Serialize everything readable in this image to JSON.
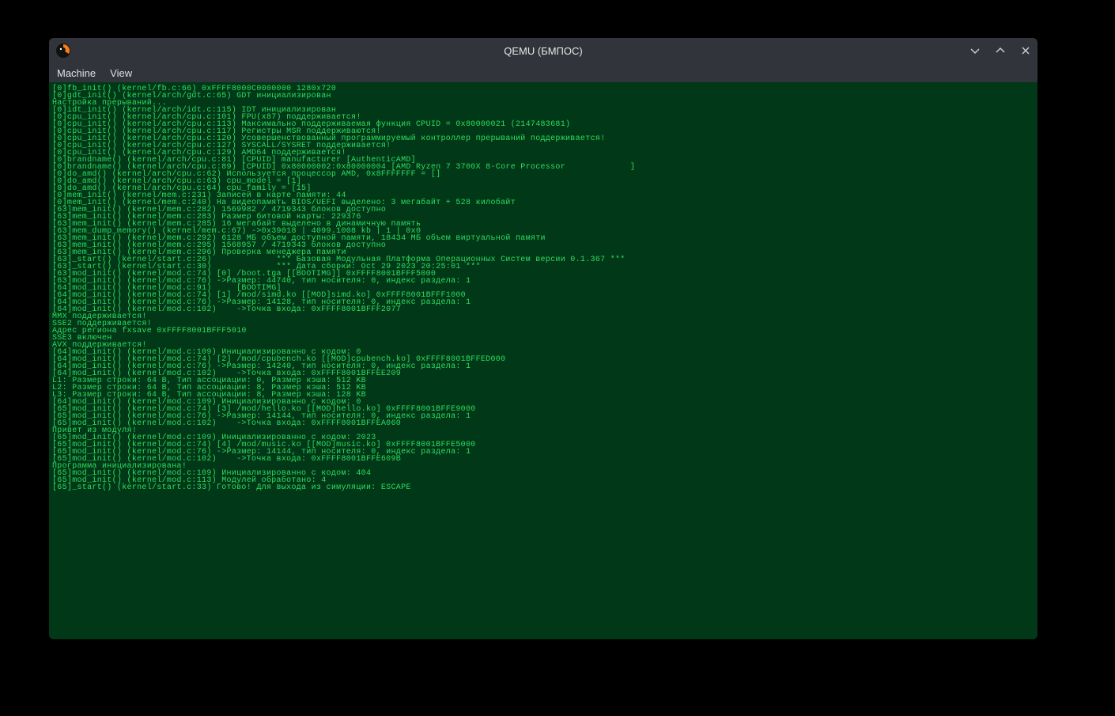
{
  "window": {
    "title": "QEMU (БМПОС)"
  },
  "menu": {
    "machine": "Machine",
    "view": "View"
  },
  "console": {
    "lines": [
      "[0]fb_init() (kernel/fb.c:66) 0xFFFF8000C0000000 1280x720",
      "[0]gdt_init() (kernel/arch/gdt.c:65) GDT инициализирован",
      "Настройка прерываний...",
      "[0]idt_init() (kernel/arch/idt.c:115) IDT инициализирован",
      "[0]cpu_init() (kernel/arch/cpu.c:101) FPU(x87) поддерживается!",
      "[0]cpu_init() (kernel/arch/cpu.c:113) Максимально поддерживаемая функция CPUID = 0x80000021 (2147483681)",
      "[0]cpu_init() (kernel/arch/cpu.c:117) Регистры MSR поддерживаются!",
      "[0]cpu_init() (kernel/arch/cpu.c:120) Усовершенствованный программируемый контроллер прерываний поддерживается!",
      "[0]cpu_init() (kernel/arch/cpu.c:127) SYSCALL/SYSRET поддерживается!",
      "[0]cpu_init() (kernel/arch/cpu.c:129) AMD64 поддерживается!",
      "[0]brandname() (kernel/arch/cpu.c:81) [CPUID] manufacturer [AuthenticAMD]",
      "[0]brandname() (kernel/arch/cpu.c:89) [CPUID] 0x80000002:0x80000004 [AMD Ryzen 7 3700X 8-Core Processor             ]",
      "[0]do_amd() (kernel/arch/cpu.c:62) Используется процессор AMD, 0x8FFFFFFF = []",
      "[0]do_amd() (kernel/arch/cpu.c:63) cpu_model = [1]",
      "[0]do_amd() (kernel/arch/cpu.c:64) cpu_family = [15]",
      "[0]mem_init() (kernel/mem.c:231) Записей в карте памяти: 44",
      "[0]mem_init() (kernel/mem.c:240) На видеопамять BIOS/UEFI выделено: 3 мегабайт + 528 килобайт",
      "[63]mem_init() (kernel/mem.c:282) 1569982 / 4719343 блоков доступно",
      "[63]mem_init() (kernel/mem.c:283) Размер битовой карты: 229376",
      "[63]mem_init() (kernel/mem.c:285) 16 мегабайт выделено в динамичную память",
      "[63]mem_dump_memory() (kernel/mem.c:67) ->0x39018 | 4099.1008 kb | 1 | 0x0",
      "[63]mem_init() (kernel/mem.c:292) 6128 МБ объем доступной памяти, 18434 МБ объем виртуальной памяти",
      "[63]mem_init() (kernel/mem.c:295) 1568957 / 4719343 блоков доступно",
      "[63]mem_init() (kernel/mem.c:296) Проверка менеджера памяти",
      "[63]_start() (kernel/start.c:26)             *** Базовая Модульная Платформа Операционных Систем версии 0.1.367 ***",
      "[63]_start() (kernel/start.c:30)             *** Дата сборки: Oct 29 2023 20:25:01 ***",
      "[63]mod_init() (kernel/mod.c:74) [0] /boot.tga [[BOOTIMG]] 0xFFFF8001BFFF5000",
      "[63]mod_init() (kernel/mod.c:76) ->Размер: 44740, тип носителя: 0, индекс раздела: 1",
      "[64]mod_init() (kernel/mod.c:91)     [BOOTIMG]",
      "[64]mod_init() (kernel/mod.c:74) [1] /mod/simd.ko [[MOD]simd.ko] 0xFFFF8001BFFF1000",
      "[64]mod_init() (kernel/mod.c:76) ->Размер: 14128, тип носителя: 0, индекс раздела: 1",
      "[64]mod_init() (kernel/mod.c:102)    ->Точка входа: 0xFFFF8001BFFF2077",
      "MMX поддерживается!",
      "SSE2 поддерживается!",
      "Адрес региона fxsave 0xFFFF8001BFFF5010",
      "SSE3 включен",
      "AVX поддерживается!",
      "[64]mod_init() (kernel/mod.c:109) Инициализированно с кодом: 0",
      "[64]mod_init() (kernel/mod.c:74) [2] /mod/cpubench.ko [[MOD]cpubench.ko] 0xFFFF8001BFFED000",
      "[64]mod_init() (kernel/mod.c:76) ->Размер: 14240, тип носителя: 0, индекс раздела: 1",
      "[64]mod_init() (kernel/mod.c:102)    ->Точка входа: 0xFFFF8001BFFEE209",
      "L1: Размер строки: 64 B, Тип ассоциации: 0, Размер кэша: 512 KB",
      "L2: Размер строки: 64 B, Тип ассоциации: 8, Размер кэша: 512 KB",
      "L3: Размер строки: 64 B, Тип ассоциации: 8, Размер кэша: 128 KB",
      "[64]mod_init() (kernel/mod.c:109) Инициализированно с кодом: 0",
      "[65]mod_init() (kernel/mod.c:74) [3] /mod/hello.ko [[MOD]hello.ko] 0xFFFF8001BFFE9000",
      "[65]mod_init() (kernel/mod.c:76) ->Размер: 14144, тип носителя: 0, индекс раздела: 1",
      "[65]mod_init() (kernel/mod.c:102)    ->Точка входа: 0xFFFF8001BFFEA060",
      "Привет из модуля!",
      "[65]mod_init() (kernel/mod.c:109) Инициализированно с кодом: 2023",
      "[65]mod_init() (kernel/mod.c:74) [4] /mod/music.ko [[MOD]music.ko] 0xFFFF8001BFFE5000",
      "[65]mod_init() (kernel/mod.c:76) ->Размер: 14144, тип носителя: 0, индекс раздела: 1",
      "[65]mod_init() (kernel/mod.c:102)    ->Точка входа: 0xFFFF8001BFFE609B",
      "Программа инициализирована!",
      "[65]mod_init() (kernel/mod.c:109) Инициализированно с кодом: 404",
      "[65]mod_init() (kernel/mod.c:113) Модулей обработано: 4",
      "[65]_start() (kernel/start.c:33) Готово! Для выхода из симуляции: ESCAPE"
    ]
  }
}
